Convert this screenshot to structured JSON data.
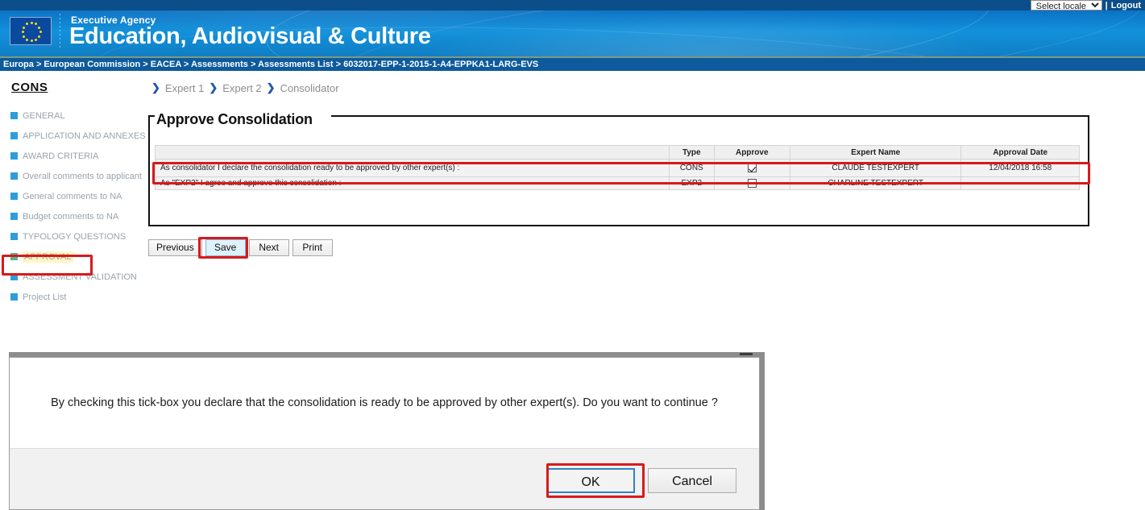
{
  "header": {
    "locale_selected": "Select locale",
    "locale_options": [
      "Select locale"
    ],
    "separator": "|",
    "logout_label": "Logout",
    "agency_eyebrow": "Executive Agency",
    "agency_title": "Education, Audiovisual & Culture",
    "breadcrumb": "Europa > European Commission > EACEA > Assessments > Assessments List > 6032017-EPP-1-2015-1-A4-EPPKA1-LARG-EVS",
    "flag_icon": "eu-flag-icon"
  },
  "sidebar": {
    "title": "CONS",
    "items": [
      {
        "label": "GENERAL",
        "active": false
      },
      {
        "label": "APPLICATION AND ANNEXES",
        "active": false
      },
      {
        "label": "AWARD CRITERIA",
        "active": false
      },
      {
        "label": "Overall comments to applicant",
        "active": false
      },
      {
        "label": "General comments to NA",
        "active": false
      },
      {
        "label": "Budget comments to NA",
        "active": false
      },
      {
        "label": "TYPOLOGY QUESTIONS",
        "active": false
      },
      {
        "label": "APPROVAL",
        "active": true
      },
      {
        "label": "ASSESSMENT VALIDATION",
        "active": false
      },
      {
        "label": "Project List",
        "active": false
      }
    ]
  },
  "expert_nav": {
    "chevron": "❯",
    "steps": [
      "Expert 1",
      "Expert 2",
      "Consolidator"
    ]
  },
  "main": {
    "legend": "Approve Consolidation",
    "table": {
      "headers": [
        "",
        "Type",
        "Approve",
        "Expert Name",
        "Approval Date"
      ],
      "rows": [
        {
          "statement": "As consolidator I declare the consolidation ready to be approved by other expert(s) :",
          "type": "CONS",
          "approved": true,
          "expert_name": "CLAUDE TESTEXPERT",
          "approval_date": "12/04/2018 16:58"
        },
        {
          "statement": "As \"EXP2\" I agree and approve this consolidation :",
          "type": "EXP2",
          "approved": false,
          "expert_name": "CHARLINE TESTEXPERT",
          "approval_date": ""
        }
      ]
    },
    "buttons": {
      "previous": "Previous",
      "save": "Save",
      "next": "Next",
      "print": "Print"
    }
  },
  "dialog": {
    "message": "By checking this tick-box you declare that the consolidation is ready to be approved by other expert(s). Do you want to continue ?",
    "ok_label": "OK",
    "cancel_label": "Cancel"
  },
  "colors": {
    "banner_blue": "#1391db",
    "topbar_blue": "#0b4e8a",
    "breadcrumb_blue": "#0d5a9c",
    "annotation_red": "#d8191b",
    "menu_square_blue": "#2e9ddb",
    "menu_square_active_green": "#52b78f",
    "menu_highlight_yellow": "#fdf6c3",
    "focus_blue": "#2f82cc"
  }
}
